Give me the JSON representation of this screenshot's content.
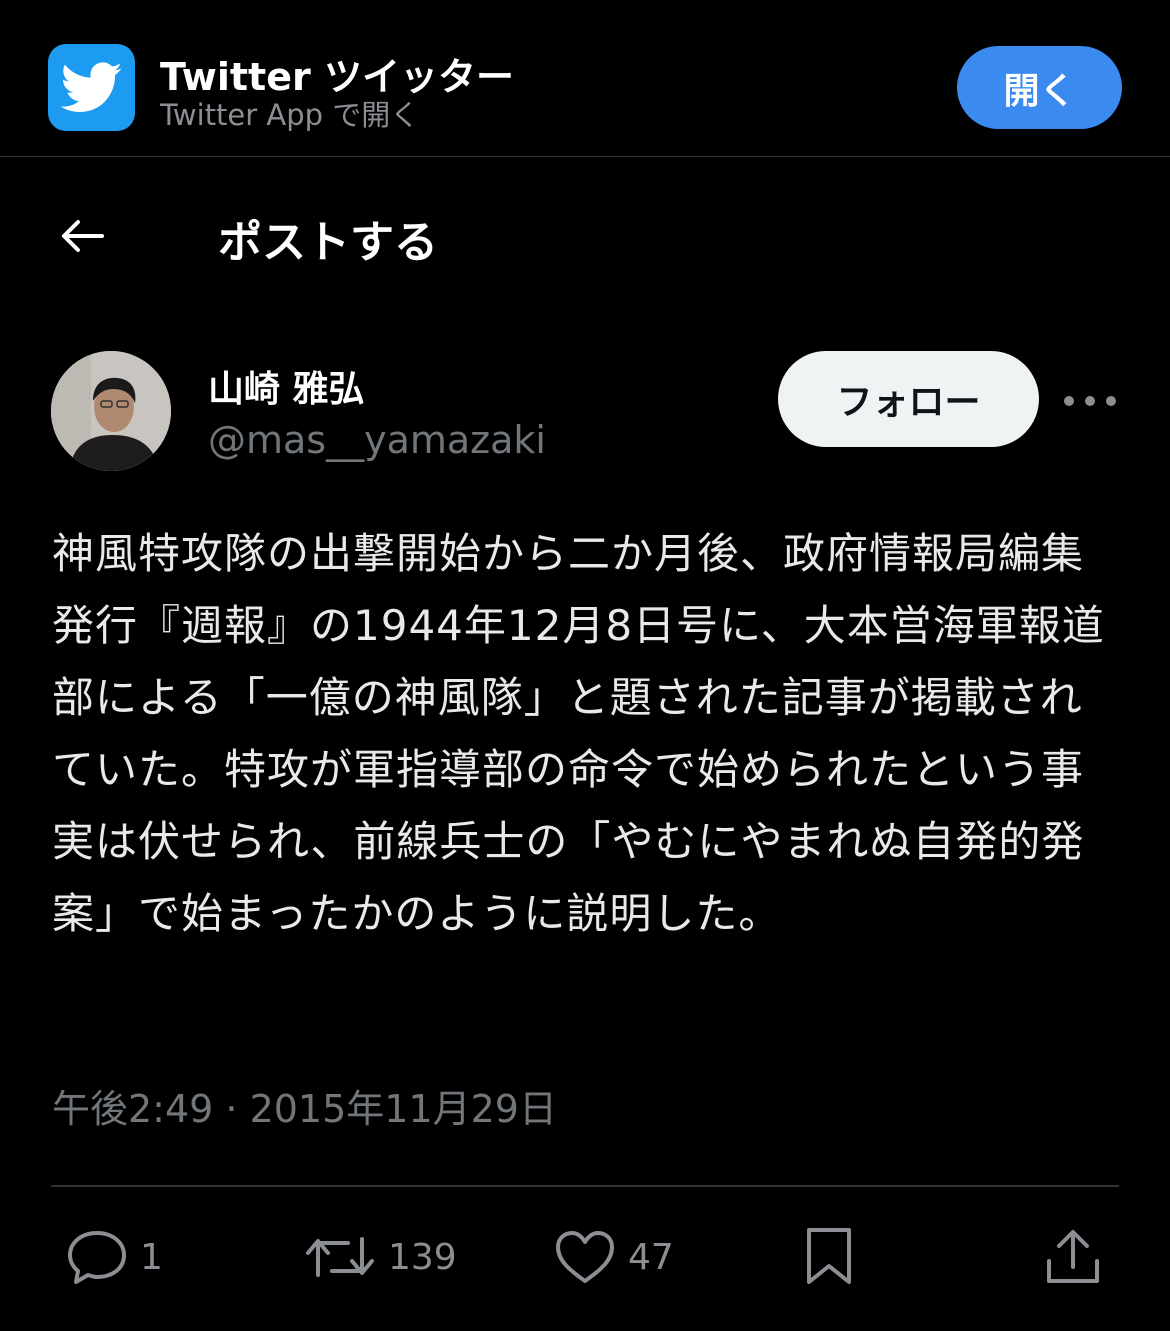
{
  "banner": {
    "app_name": "Twitter ツイッター",
    "subtitle": "Twitter App で開く",
    "open_label": "開く"
  },
  "header": {
    "title": "ポストする"
  },
  "author": {
    "name": "山崎 雅弘",
    "handle": "@mas__yamazaki",
    "follow_label": "フォロー"
  },
  "tweet": {
    "text": "神風特攻隊の出撃開始から二か月後、政府情報局編集発行『週報』の1944年12月8日号に、大本営海軍報道部による「一億の神風隊」と題された記事が掲載されていた。特攻が軍指導部の命令で始められたという事実は伏せられ、前線兵士の「やむにやまれぬ自発的発案」で始まったかのように説明した。",
    "timestamp": "午後2:49 · 2015年11月29日"
  },
  "actions": {
    "replies": "1",
    "retweets": "139",
    "likes": "47"
  },
  "colors": {
    "background": "#000000",
    "text": "#e7e9ea",
    "muted": "#71767b",
    "accent": "#3b8af0",
    "twitter_blue": "#1d9bf0"
  },
  "icons": [
    "twitter-bird-icon",
    "back-arrow-icon",
    "more-icon",
    "reply-icon",
    "retweet-icon",
    "like-icon",
    "bookmark-icon",
    "share-icon"
  ]
}
